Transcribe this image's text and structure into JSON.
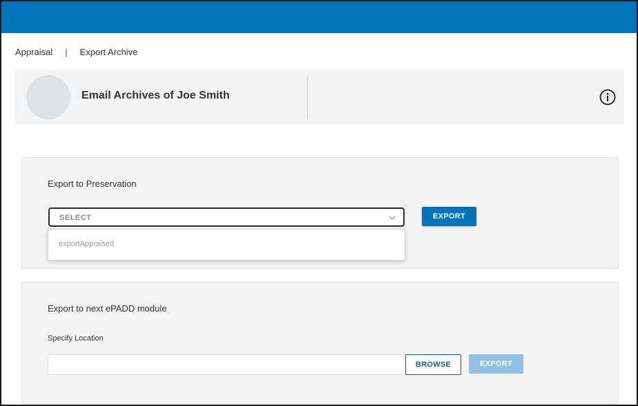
{
  "colors": {
    "top_bar": "#0075bc",
    "primary_button": "#0075bc",
    "disabled_button": "#8fc1e3",
    "panel_bg": "#f3f3f4"
  },
  "breadcrumb": {
    "items": [
      "Appraisal",
      "Export Archive"
    ],
    "separator": "|"
  },
  "header": {
    "title": "Email Archives of Joe Smith",
    "info_icon": "info-icon"
  },
  "preservation": {
    "heading": "Export to Preservation",
    "select": {
      "value": "SELECT",
      "options": [
        "exportAppraised"
      ]
    },
    "export_label": "EXPORT"
  },
  "next_module": {
    "heading": "Export to next ePADD module",
    "location_label": "Specify Location",
    "location_value": "",
    "browse_label": "BROWSE",
    "export_label": "EXPORT"
  }
}
